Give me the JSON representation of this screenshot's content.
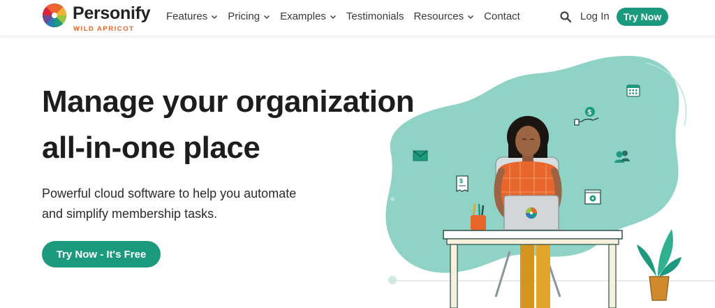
{
  "brand": {
    "name": "Personify",
    "tagline": "WILD APRICOT",
    "accent": "#1c9a7d",
    "orange": "#e8662b"
  },
  "nav": {
    "items": [
      {
        "label": "Features",
        "has_dropdown": true
      },
      {
        "label": "Pricing",
        "has_dropdown": true
      },
      {
        "label": "Examples",
        "has_dropdown": true
      },
      {
        "label": "Testimonials",
        "has_dropdown": false
      },
      {
        "label": "Resources",
        "has_dropdown": true
      },
      {
        "label": "Contact",
        "has_dropdown": false
      }
    ],
    "search_icon": "search-icon",
    "login_label": "Log In",
    "try_now_label": "Try Now"
  },
  "hero": {
    "headline_line1": "Manage your organization",
    "headline_line2": "all-in-one place",
    "subtext_line1": "Powerful cloud software to help you automate",
    "subtext_line2": "and simplify membership tasks.",
    "cta_label": "Try Now - It's Free"
  },
  "illustration": {
    "blob_color": "#8fd3c6",
    "icons": [
      "calendar-icon",
      "money-hand-icon",
      "email-icon",
      "people-icon",
      "receipt-icon",
      "settings-window-icon"
    ]
  }
}
